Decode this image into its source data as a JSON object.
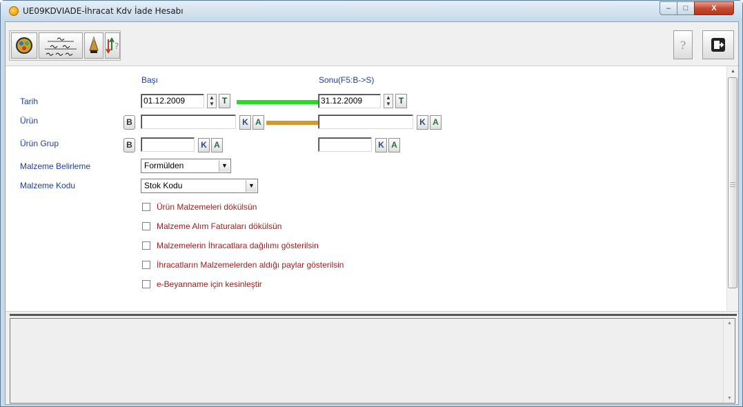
{
  "window": {
    "title": "UE09KDVIADE-İhracat Kdv İade Hesabı",
    "minimize_glyph": "‒",
    "maximize_glyph": "□",
    "close_glyph": "X"
  },
  "toolbar": {
    "help_glyph": "?",
    "left_buttons": [
      "run-icon",
      "signatures-icon",
      "bell-icon",
      "sort-help-icon"
    ],
    "right_buttons": [
      "help-icon",
      "exit-icon"
    ]
  },
  "form": {
    "col_start_header": "Başı",
    "col_end_header": "Sonu(F5:B->S)",
    "tarih": {
      "label": "Tarih",
      "start_value": "01.12.2009",
      "end_value": "31.12.2009",
      "today_btn": "T",
      "bar_color": "#22dd22"
    },
    "urun": {
      "label": "Ürün",
      "start_value": "",
      "end_value": "",
      "browse_btn": "B",
      "k_btn": "K",
      "a_btn": "A",
      "bar_color": "#d29a2b"
    },
    "urun_grup": {
      "label": "Ürün Grup",
      "start_value": "",
      "end_value": "",
      "browse_btn": "B",
      "k_btn": "K",
      "a_btn": "A"
    },
    "malzeme_belirleme": {
      "label": "Malzeme Belirleme",
      "selected": "Formülden"
    },
    "malzeme_kodu": {
      "label": "Malzeme Kodu",
      "selected": "Stok Kodu"
    },
    "checkboxes": [
      {
        "label": "Ürün Malzemeleri dökülsün",
        "checked": false
      },
      {
        "label": "Malzeme Alım Faturaları dökülsün",
        "checked": false
      },
      {
        "label": "Malzemelerin İhracatlara dağılımı gösterilsin",
        "checked": false
      },
      {
        "label": "İhracatların Malzemelerden aldığı paylar gösterilsin",
        "checked": false
      },
      {
        "label": "e-Beyanname için kesinleştir",
        "checked": false
      }
    ]
  },
  "memo": {
    "text": ""
  }
}
